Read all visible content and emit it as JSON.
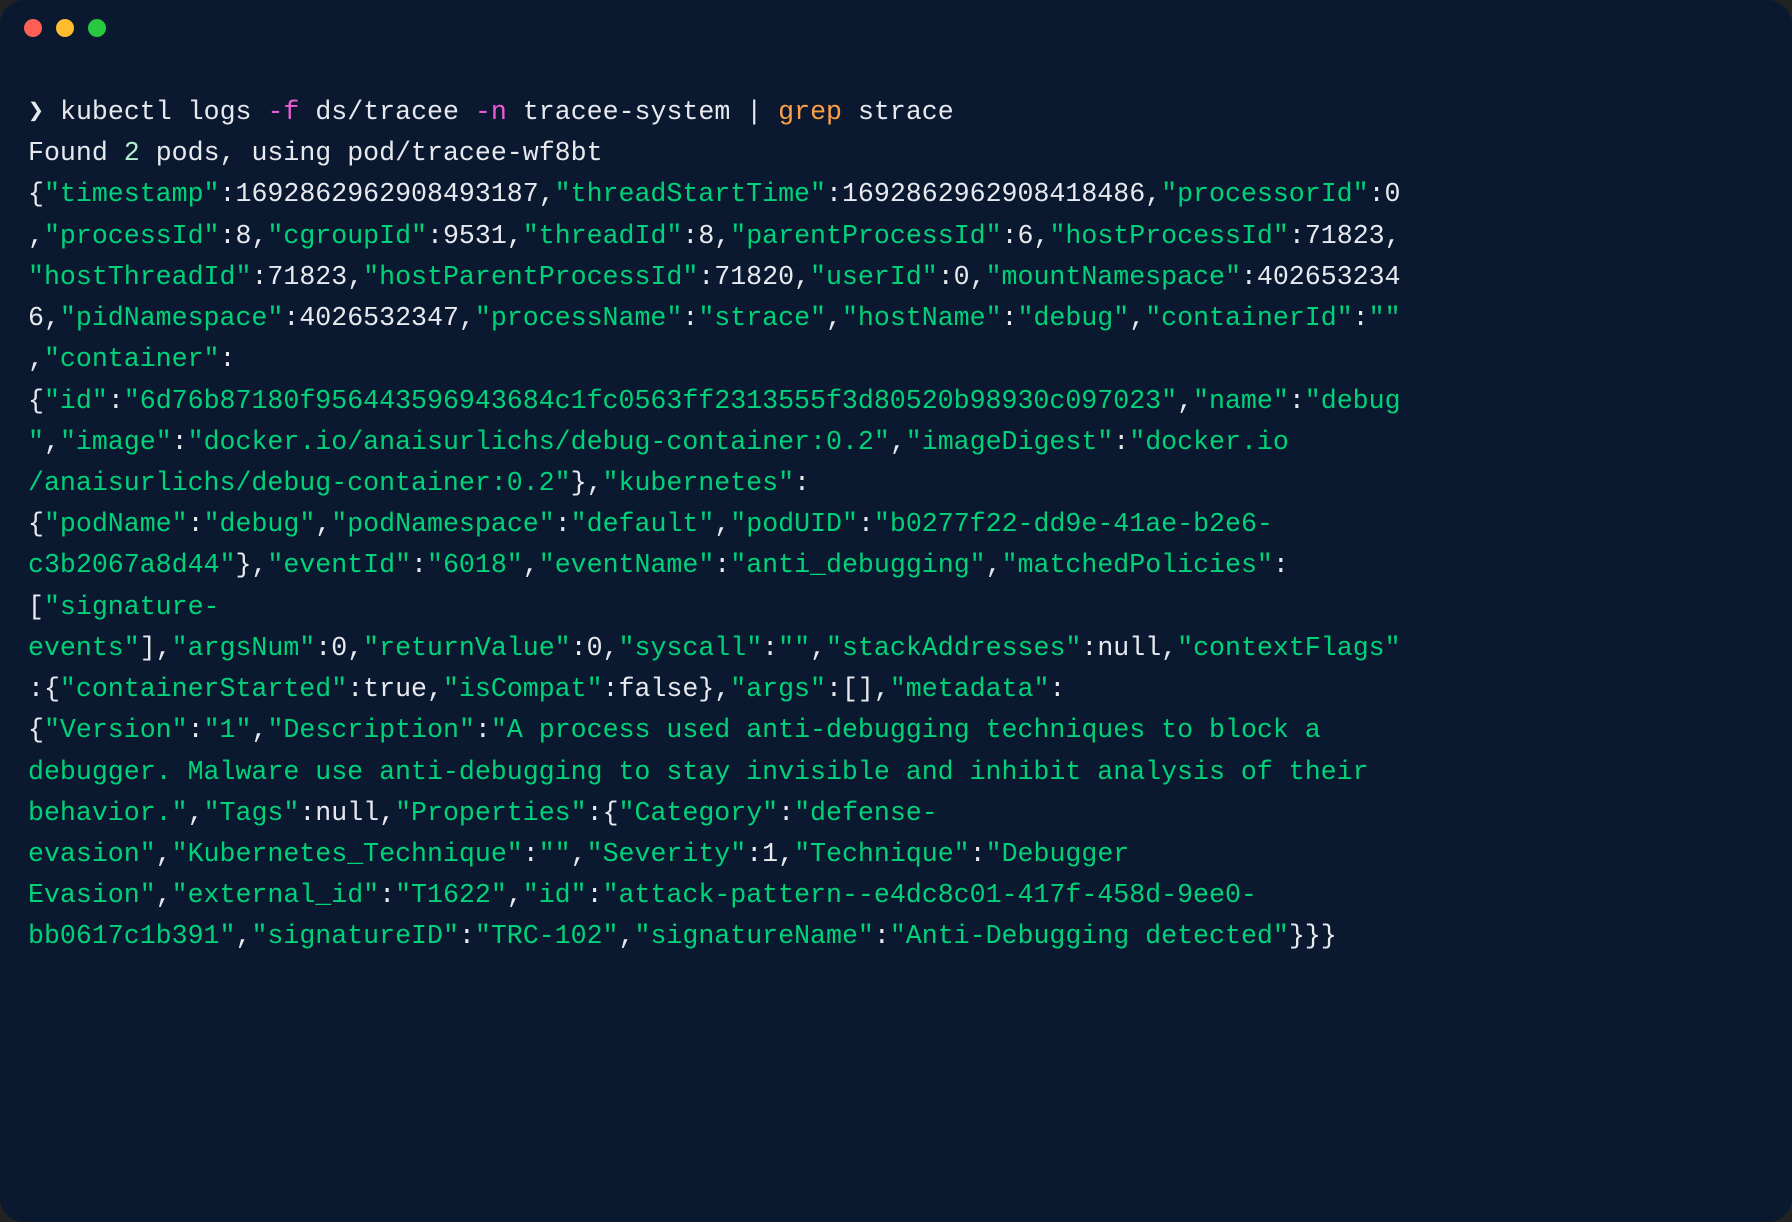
{
  "titlebar": {
    "dots": [
      "red",
      "yellow",
      "green"
    ]
  },
  "prompt": {
    "symbol": "❯"
  },
  "command": {
    "cmd1": "kubectl logs ",
    "flag": "-f",
    "cmd2": " ds/tracee ",
    "flagn": "-n",
    "cmd3": " tracee-system | ",
    "grep": "grep",
    "cmd4": " strace"
  },
  "found": {
    "a": "Found ",
    "n": "2",
    "b": " pods, using pod/tracee-wf8bt"
  },
  "chunks": [
    {
      "c": "w",
      "t": "{"
    },
    {
      "c": "g",
      "t": "\"timestamp\""
    },
    {
      "c": "w",
      "t": ":1692862962908493187,"
    },
    {
      "c": "g",
      "t": "\"threadStartTime\""
    },
    {
      "c": "w",
      "t": ":1692862962908418486,"
    },
    {
      "c": "g",
      "t": "\"processorId\""
    },
    {
      "c": "w",
      "t": ":0\n,"
    },
    {
      "c": "g",
      "t": "\"processId\""
    },
    {
      "c": "w",
      "t": ":8,"
    },
    {
      "c": "g",
      "t": "\"cgroupId\""
    },
    {
      "c": "w",
      "t": ":9531,"
    },
    {
      "c": "g",
      "t": "\"threadId\""
    },
    {
      "c": "w",
      "t": ":8,"
    },
    {
      "c": "g",
      "t": "\"parentProcessId\""
    },
    {
      "c": "w",
      "t": ":6,"
    },
    {
      "c": "g",
      "t": "\"hostProcessId\""
    },
    {
      "c": "w",
      "t": ":71823,\n"
    },
    {
      "c": "g",
      "t": "\"hostThreadId\""
    },
    {
      "c": "w",
      "t": ":71823,"
    },
    {
      "c": "g",
      "t": "\"hostParentProcessId\""
    },
    {
      "c": "w",
      "t": ":71820,"
    },
    {
      "c": "g",
      "t": "\"userId\""
    },
    {
      "c": "w",
      "t": ":0,"
    },
    {
      "c": "g",
      "t": "\"mountNamespace\""
    },
    {
      "c": "w",
      "t": ":402653234\n6,"
    },
    {
      "c": "g",
      "t": "\"pidNamespace\""
    },
    {
      "c": "w",
      "t": ":4026532347,"
    },
    {
      "c": "g",
      "t": "\"processName\""
    },
    {
      "c": "w",
      "t": ":"
    },
    {
      "c": "g",
      "t": "\"strace\""
    },
    {
      "c": "w",
      "t": ","
    },
    {
      "c": "g",
      "t": "\"hostName\""
    },
    {
      "c": "w",
      "t": ":"
    },
    {
      "c": "g",
      "t": "\"debug\""
    },
    {
      "c": "w",
      "t": ","
    },
    {
      "c": "g",
      "t": "\"containerId\""
    },
    {
      "c": "w",
      "t": ":"
    },
    {
      "c": "g",
      "t": "\"\""
    },
    {
      "c": "w",
      "t": "\n,"
    },
    {
      "c": "g",
      "t": "\"container\""
    },
    {
      "c": "w",
      "t": ":\n{"
    },
    {
      "c": "g",
      "t": "\"id\""
    },
    {
      "c": "w",
      "t": ":"
    },
    {
      "c": "g",
      "t": "\"6d76b87180f956443596943684c1fc0563ff2313555f3d80520b98930c097023\""
    },
    {
      "c": "w",
      "t": ","
    },
    {
      "c": "g",
      "t": "\"name\""
    },
    {
      "c": "w",
      "t": ":"
    },
    {
      "c": "g",
      "t": "\"debug\n\""
    },
    {
      "c": "w",
      "t": ","
    },
    {
      "c": "g",
      "t": "\"image\""
    },
    {
      "c": "w",
      "t": ":"
    },
    {
      "c": "g",
      "t": "\"docker.io/anaisurlichs/debug-container:0.2\""
    },
    {
      "c": "w",
      "t": ","
    },
    {
      "c": "g",
      "t": "\"imageDigest\""
    },
    {
      "c": "w",
      "t": ":"
    },
    {
      "c": "g",
      "t": "\"docker.io\n/anaisurlichs/debug-container:0.2\""
    },
    {
      "c": "w",
      "t": "},"
    },
    {
      "c": "g",
      "t": "\"kubernetes\""
    },
    {
      "c": "w",
      "t": ":\n{"
    },
    {
      "c": "g",
      "t": "\"podName\""
    },
    {
      "c": "w",
      "t": ":"
    },
    {
      "c": "g",
      "t": "\"debug\""
    },
    {
      "c": "w",
      "t": ","
    },
    {
      "c": "g",
      "t": "\"podNamespace\""
    },
    {
      "c": "w",
      "t": ":"
    },
    {
      "c": "g",
      "t": "\"default\""
    },
    {
      "c": "w",
      "t": ","
    },
    {
      "c": "g",
      "t": "\"podUID\""
    },
    {
      "c": "w",
      "t": ":"
    },
    {
      "c": "g",
      "t": "\"b0277f22-dd9e-41ae-b2e6-\nc3b2067a8d44\""
    },
    {
      "c": "w",
      "t": "},"
    },
    {
      "c": "g",
      "t": "\"eventId\""
    },
    {
      "c": "w",
      "t": ":"
    },
    {
      "c": "g",
      "t": "\"6018\""
    },
    {
      "c": "w",
      "t": ","
    },
    {
      "c": "g",
      "t": "\"eventName\""
    },
    {
      "c": "w",
      "t": ":"
    },
    {
      "c": "g",
      "t": "\"anti_debugging\""
    },
    {
      "c": "w",
      "t": ","
    },
    {
      "c": "g",
      "t": "\"matchedPolicies\""
    },
    {
      "c": "w",
      "t": ":\n["
    },
    {
      "c": "g",
      "t": "\"signature-\nevents\""
    },
    {
      "c": "w",
      "t": "],"
    },
    {
      "c": "g",
      "t": "\"argsNum\""
    },
    {
      "c": "w",
      "t": ":0,"
    },
    {
      "c": "g",
      "t": "\"returnValue\""
    },
    {
      "c": "w",
      "t": ":0,"
    },
    {
      "c": "g",
      "t": "\"syscall\""
    },
    {
      "c": "w",
      "t": ":"
    },
    {
      "c": "g",
      "t": "\"\""
    },
    {
      "c": "w",
      "t": ","
    },
    {
      "c": "g",
      "t": "\"stackAddresses\""
    },
    {
      "c": "w",
      "t": ":null,"
    },
    {
      "c": "g",
      "t": "\"contextFlags\""
    },
    {
      "c": "w",
      "t": "\n:{"
    },
    {
      "c": "g",
      "t": "\"containerStarted\""
    },
    {
      "c": "w",
      "t": ":true,"
    },
    {
      "c": "g",
      "t": "\"isCompat\""
    },
    {
      "c": "w",
      "t": ":false},"
    },
    {
      "c": "g",
      "t": "\"args\""
    },
    {
      "c": "w",
      "t": ":[],"
    },
    {
      "c": "g",
      "t": "\"metadata\""
    },
    {
      "c": "w",
      "t": ":\n{"
    },
    {
      "c": "g",
      "t": "\"Version\""
    },
    {
      "c": "w",
      "t": ":"
    },
    {
      "c": "g",
      "t": "\"1\""
    },
    {
      "c": "w",
      "t": ","
    },
    {
      "c": "g",
      "t": "\"Description\""
    },
    {
      "c": "w",
      "t": ":"
    },
    {
      "c": "g",
      "t": "\"A process used anti-debugging techniques to block a \ndebugger. Malware use anti-debugging to stay invisible and inhibit analysis of their \nbehavior.\""
    },
    {
      "c": "w",
      "t": ","
    },
    {
      "c": "g",
      "t": "\"Tags\""
    },
    {
      "c": "w",
      "t": ":null,"
    },
    {
      "c": "g",
      "t": "\"Properties\""
    },
    {
      "c": "w",
      "t": ":{"
    },
    {
      "c": "g",
      "t": "\"Category\""
    },
    {
      "c": "w",
      "t": ":"
    },
    {
      "c": "g",
      "t": "\"defense-\nevasion\""
    },
    {
      "c": "w",
      "t": ","
    },
    {
      "c": "g",
      "t": "\"Kubernetes_Technique\""
    },
    {
      "c": "w",
      "t": ":"
    },
    {
      "c": "g",
      "t": "\"\""
    },
    {
      "c": "w",
      "t": ","
    },
    {
      "c": "g",
      "t": "\"Severity\""
    },
    {
      "c": "w",
      "t": ":1,"
    },
    {
      "c": "g",
      "t": "\"Technique\""
    },
    {
      "c": "w",
      "t": ":"
    },
    {
      "c": "g",
      "t": "\"Debugger \nEvasion\""
    },
    {
      "c": "w",
      "t": ","
    },
    {
      "c": "g",
      "t": "\"external_id\""
    },
    {
      "c": "w",
      "t": ":"
    },
    {
      "c": "g",
      "t": "\"T1622\""
    },
    {
      "c": "w",
      "t": ","
    },
    {
      "c": "g",
      "t": "\"id\""
    },
    {
      "c": "w",
      "t": ":"
    },
    {
      "c": "g",
      "t": "\"attack-pattern--e4dc8c01-417f-458d-9ee0-\nbb0617c1b391\""
    },
    {
      "c": "w",
      "t": ","
    },
    {
      "c": "g",
      "t": "\"signatureID\""
    },
    {
      "c": "w",
      "t": ":"
    },
    {
      "c": "g",
      "t": "\"TRC-102\""
    },
    {
      "c": "w",
      "t": ","
    },
    {
      "c": "g",
      "t": "\"signatureName\""
    },
    {
      "c": "w",
      "t": ":"
    },
    {
      "c": "g",
      "t": "\"Anti-Debugging detected\""
    },
    {
      "c": "w",
      "t": "}}}"
    }
  ],
  "event": {
    "timestamp": 1692862962908493187,
    "threadStartTime": 1692862962908418486,
    "processorId": 0,
    "processId": 8,
    "cgroupId": 9531,
    "threadId": 8,
    "parentProcessId": 6,
    "hostProcessId": 71823,
    "hostThreadId": 71823,
    "hostParentProcessId": 71820,
    "userId": 0,
    "mountNamespace": 4026532346,
    "pidNamespace": 4026532347,
    "processName": "strace",
    "hostName": "debug",
    "containerId": "",
    "container": {
      "id": "6d76b87180f956443596943684c1fc0563ff2313555f3d80520b98930c097023",
      "name": "debug",
      "image": "docker.io/anaisurlichs/debug-container:0.2",
      "imageDigest": "docker.io/anaisurlichs/debug-container:0.2"
    },
    "kubernetes": {
      "podName": "debug",
      "podNamespace": "default",
      "podUID": "b0277f22-dd9e-41ae-b2e6-c3b2067a8d44"
    },
    "eventId": "6018",
    "eventName": "anti_debugging",
    "matchedPolicies": [
      "signature-events"
    ],
    "argsNum": 0,
    "returnValue": 0,
    "syscall": "",
    "stackAddresses": null,
    "contextFlags": {
      "containerStarted": true,
      "isCompat": false
    },
    "args": [],
    "metadata": {
      "Version": "1",
      "Description": "A process used anti-debugging techniques to block a debugger. Malware use anti-debugging to stay invisible and inhibit analysis of their behavior.",
      "Tags": null,
      "Properties": {
        "Category": "defense-evasion",
        "Kubernetes_Technique": "",
        "Severity": 1,
        "Technique": "Debugger Evasion",
        "external_id": "T1622",
        "id": "attack-pattern--e4dc8c01-417f-458d-9ee0-bb0617c1b391",
        "signatureID": "TRC-102",
        "signatureName": "Anti-Debugging detected"
      }
    }
  }
}
